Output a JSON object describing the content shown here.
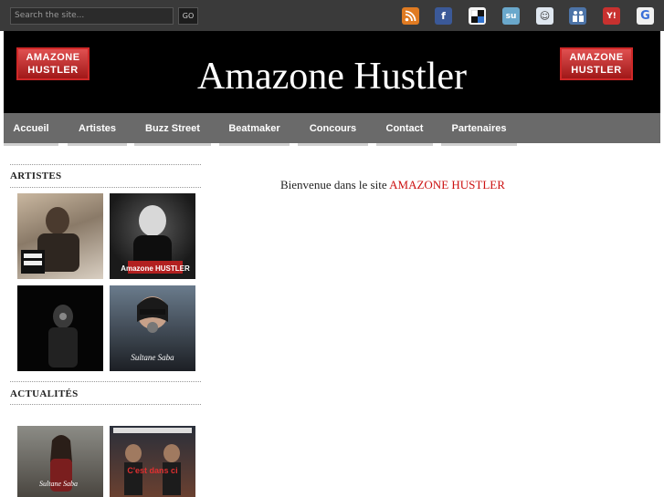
{
  "search": {
    "placeholder": "Search the site...",
    "go_label": "GO"
  },
  "social_icons": [
    {
      "name": "rss-icon",
      "glyph": ")",
      "color": "#e07b22"
    },
    {
      "name": "facebook-icon",
      "glyph": "f",
      "color": "#3b5998"
    },
    {
      "name": "delicious-icon",
      "glyph": "■",
      "color": "#dddddd"
    },
    {
      "name": "stumbleupon-icon",
      "glyph": "su",
      "color": "#5ea0c8"
    },
    {
      "name": "reddit-icon",
      "glyph": "☺",
      "color": "#cfd9e6"
    },
    {
      "name": "myspace-icon",
      "glyph": "m",
      "color": "#4d74a8"
    },
    {
      "name": "yahoo-icon",
      "glyph": "Y!",
      "color": "#c8312f"
    },
    {
      "name": "google-icon",
      "glyph": "G",
      "color": "#e8e8e8"
    }
  ],
  "header": {
    "title": "Amazone Hustler",
    "logo_text": "Amazone HUSTLER"
  },
  "nav": {
    "items": [
      {
        "label": "Accueil"
      },
      {
        "label": "Artistes"
      },
      {
        "label": "Buzz Street"
      },
      {
        "label": "Beatmaker"
      },
      {
        "label": "Concours"
      },
      {
        "label": "Contact"
      },
      {
        "label": "Partenaires"
      }
    ]
  },
  "sidebar": {
    "artistes_title": "ARTISTES",
    "actualites_title": "ACTUALITÉS",
    "thumb_labels": [
      "Amazone HUSTLER",
      "Sultane Saba",
      "C'est dans ci"
    ]
  },
  "main": {
    "welcome_prefix": "Bienvenue dans le site ",
    "welcome_highlight": "AMAZONE HUSTLER"
  },
  "colors": {
    "topbar": "#3a3a3a",
    "nav": "#6a6a6a",
    "accent": "#cc1111"
  }
}
